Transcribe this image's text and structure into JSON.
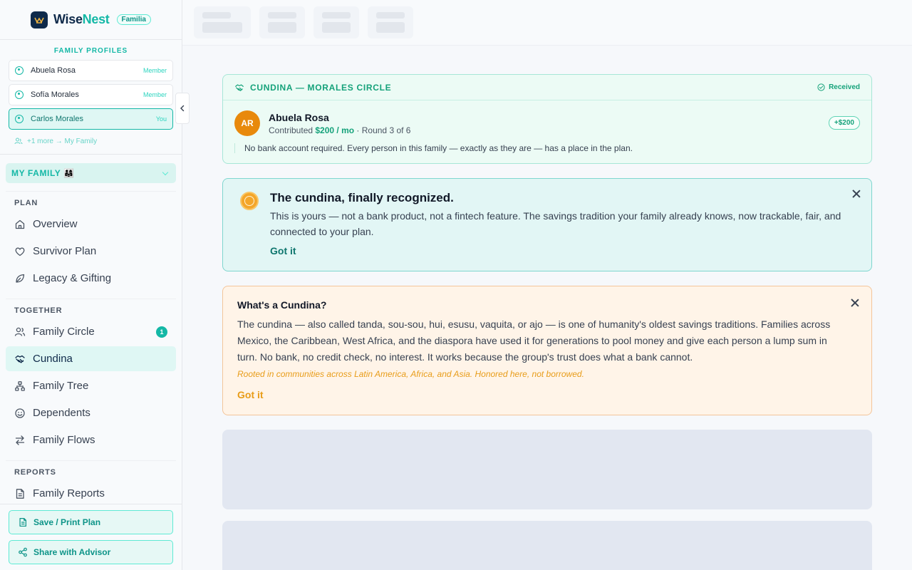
{
  "brand": {
    "name_part1": "Wise",
    "name_part2": "Nest",
    "badge": "Familia"
  },
  "profiles": {
    "heading": "FAMILY PROFILES",
    "items": [
      {
        "name": "Abuela Rosa",
        "role": "Member"
      },
      {
        "name": "Sofía Morales",
        "role": "Member"
      },
      {
        "name": "Carlos Morales",
        "role": "You"
      }
    ],
    "more": "+1 more → My Family"
  },
  "family_select": {
    "label": "MY FAMILY 👨‍👩‍👧"
  },
  "nav": {
    "plan": {
      "title": "PLAN",
      "items": [
        "Overview",
        "Survivor Plan",
        "Legacy & Gifting"
      ]
    },
    "together": {
      "title": "TOGETHER",
      "items": [
        "Family Circle",
        "Cundina",
        "Family Tree",
        "Dependents",
        "Family Flows"
      ],
      "badge": "1"
    },
    "reports": {
      "title": "REPORTS",
      "items": [
        "Family Reports"
      ]
    }
  },
  "footer": {
    "save": "Save / Print Plan",
    "share": "Share with Advisor"
  },
  "received_card": {
    "title": "CUNDINA — MORALES CIRCLE",
    "status": "Received",
    "avatar": "AR",
    "name": "Abuela Rosa",
    "sub_prefix": "Contributed ",
    "amount": "$200 / mo",
    "sub_suffix": " · Round 3 of 6",
    "pill": "+$200",
    "note": "No bank account required. Every person in this family — exactly as they are — has a place in the plan."
  },
  "recognized_card": {
    "title": "The cundina, finally recognized.",
    "text": "This is yours — not a bank product, not a fintech feature. The savings tradition your family already knows, now trackable, fair, and connected to your plan.",
    "link": "Got it"
  },
  "info_card": {
    "title": "What's a Cundina?",
    "text": "The cundina — also called tanda, sou-sou, hui, esusu, vaquita, or ajo — is one of humanity's oldest savings traditions. Families across Mexico, the Caribbean, West Africa, and the diaspora have used it for generations to pool money and give each person a lump sum in turn. No bank, no credit check, no interest. It works because the group's trust does what a bank cannot.",
    "quote": "Rooted in communities across Latin America, Africa, and Asia. Honored here, not borrowed.",
    "link": "Got it"
  },
  "colors": {
    "accent": "#14b8a6",
    "navy": "#0f2a4a",
    "success": "#15a27a",
    "warning": "#e89c18"
  },
  "icons": [
    "wisenest-logo-icon",
    "user-circle-icon",
    "users-icon",
    "chevron-down-icon",
    "home-icon",
    "heart-icon",
    "leaf-icon",
    "handshake-icon",
    "tree-icon",
    "smile-icon",
    "arrows-swap-icon",
    "document-icon",
    "share-icon",
    "chevron-left-icon",
    "check-circle-icon",
    "coin-icon",
    "close-icon"
  ]
}
